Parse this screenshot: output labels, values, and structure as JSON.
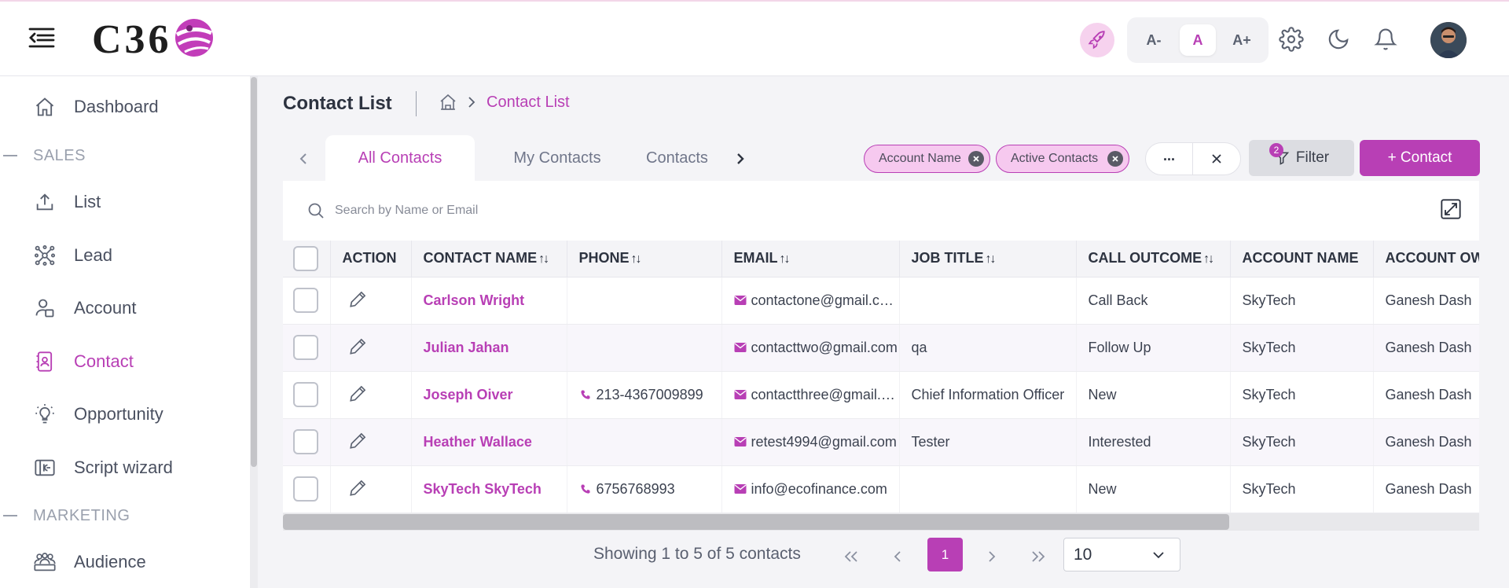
{
  "header": {
    "logo_text": "C36",
    "font_controls": [
      "A-",
      "A",
      "A+"
    ],
    "font_active": 1
  },
  "colors": {
    "accent": "#b83fb5",
    "chip_bg": "#f6c9ef",
    "rocket_bg": "#f6d2ee"
  },
  "sidebar": {
    "items": [
      {
        "label": "Dashboard",
        "icon": "home-icon"
      },
      {
        "label": "List",
        "icon": "upload-icon"
      },
      {
        "label": "Lead",
        "icon": "network-icon"
      },
      {
        "label": "Account",
        "icon": "account-icon"
      },
      {
        "label": "Contact",
        "icon": "contact-card-icon",
        "active": true
      },
      {
        "label": "Opportunity",
        "icon": "lightbulb-icon"
      },
      {
        "label": "Script wizard",
        "icon": "script-icon"
      },
      {
        "label": "Audience",
        "icon": "audience-icon"
      }
    ],
    "sections": [
      "SALES",
      "MARKETING"
    ]
  },
  "page": {
    "title": "Contact List",
    "breadcrumb_current": "Contact List"
  },
  "tabs": [
    {
      "label": "All Contacts",
      "active": true
    },
    {
      "label": "My Contacts"
    },
    {
      "label": "Contacts"
    }
  ],
  "filters": {
    "chips": [
      "Account Name",
      "Active Contacts"
    ],
    "more_label": "...",
    "filter_label": "Filter",
    "filter_count": "2",
    "add_label": "+ Contact"
  },
  "search": {
    "placeholder": "Search by Name or Email",
    "value": ""
  },
  "table": {
    "columns": [
      "ACTION",
      "CONTACT NAME",
      "PHONE",
      "EMAIL",
      "JOB TITLE",
      "CALL OUTCOME",
      "ACCOUNT NAME",
      "ACCOUNT OWNER"
    ],
    "rows": [
      {
        "name": "Carlson Wright",
        "phone": "",
        "email": "contactone@gmail.com",
        "job": "",
        "outcome": "Call Back",
        "account": "SkyTech",
        "owner": "Ganesh Dash"
      },
      {
        "name": "Julian Jahan",
        "phone": "",
        "email": "contacttwo@gmail.com",
        "job": "qa",
        "outcome": "Follow Up",
        "account": "SkyTech",
        "owner": "Ganesh Dash"
      },
      {
        "name": "Joseph Oiver",
        "phone": "213-4367009899",
        "email": "contactthree@gmail.com",
        "job": "Chief Information Officer",
        "outcome": "New",
        "account": "SkyTech",
        "owner": "Ganesh Dash"
      },
      {
        "name": "Heather Wallace",
        "phone": "",
        "email": "retest4994@gmail.com",
        "job": "Tester",
        "outcome": "Interested",
        "account": "SkyTech",
        "owner": "Ganesh Dash"
      },
      {
        "name": "SkyTech SkyTech",
        "phone": "6756768993",
        "email": "info@ecofinance.com",
        "job": "",
        "outcome": "New",
        "account": "SkyTech",
        "owner": "Ganesh Dash"
      }
    ]
  },
  "pagination": {
    "info": "Showing 1 to 5 of 5 contacts",
    "current_page": "1",
    "page_size": "10"
  }
}
